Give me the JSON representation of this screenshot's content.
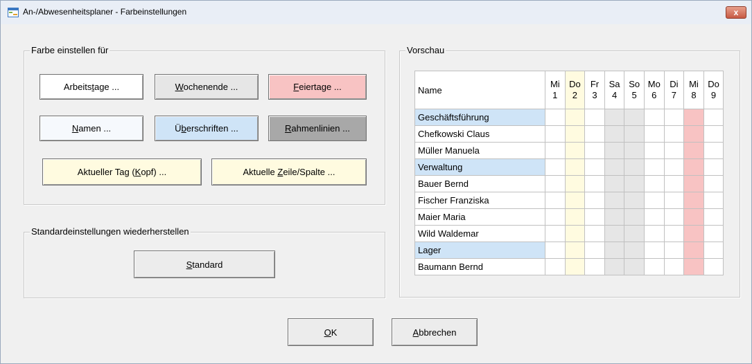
{
  "window": {
    "title": "An-/Abwesenheitsplaner - Farbeinstellungen",
    "close_label": "x"
  },
  "colors": {
    "titlebar": "#e9eef6",
    "dialog_bg": "#f0f0f0",
    "workdays_bg": "#ffffff",
    "weekend_bg": "#e6e6e6",
    "holidays_bg": "#f8c3c3",
    "names_bg": "#f6f9fd",
    "headings_bg": "#cfe4f7",
    "frame_lines_bg": "#a8a8a8",
    "today_bg": "#fffbe0"
  },
  "color_group": {
    "legend": "Farbe einstellen für",
    "buttons": {
      "workdays": {
        "pre": "Arbeits",
        "acc": "t",
        "post": "age ..."
      },
      "weekend": {
        "pre": "",
        "acc": "W",
        "post": "ochenende ..."
      },
      "holidays": {
        "pre": "",
        "acc": "F",
        "post": "eiertage ..."
      },
      "names": {
        "pre": "",
        "acc": "N",
        "post": "amen ..."
      },
      "headings": {
        "pre": "Ü",
        "acc": "b",
        "post": "erschriften ..."
      },
      "frame_lines": {
        "pre": "",
        "acc": "R",
        "post": "ahmenlinien ..."
      },
      "today_head": {
        "pre": "Aktueller Tag (",
        "acc": "K",
        "post": "opf) ..."
      },
      "current_row": {
        "pre": "Aktuelle ",
        "acc": "Z",
        "post": "eile/Spalte ..."
      }
    }
  },
  "defaults_group": {
    "legend": "Standardeinstellungen wiederherstellen",
    "button": {
      "pre": "",
      "acc": "S",
      "post": "tandard"
    }
  },
  "preview": {
    "legend": "Vorschau",
    "name_header": "Name",
    "days": [
      {
        "dow": "Mi",
        "num": "1",
        "type": "work"
      },
      {
        "dow": "Do",
        "num": "2",
        "type": "today"
      },
      {
        "dow": "Fr",
        "num": "3",
        "type": "work"
      },
      {
        "dow": "Sa",
        "num": "4",
        "type": "weekend"
      },
      {
        "dow": "So",
        "num": "5",
        "type": "weekend"
      },
      {
        "dow": "Mo",
        "num": "6",
        "type": "work"
      },
      {
        "dow": "Di",
        "num": "7",
        "type": "work"
      },
      {
        "dow": "Mi",
        "num": "8",
        "type": "holiday"
      },
      {
        "dow": "Do",
        "num": "9",
        "type": "work"
      }
    ],
    "rows": [
      {
        "name": "Geschäftsführung",
        "kind": "group"
      },
      {
        "name": "Chefkowski Claus",
        "kind": "person"
      },
      {
        "name": "Müller Manuela",
        "kind": "person"
      },
      {
        "name": "Verwaltung",
        "kind": "group"
      },
      {
        "name": "Bauer Bernd",
        "kind": "person"
      },
      {
        "name": "Fischer Franziska",
        "kind": "person"
      },
      {
        "name": "Maier Maria",
        "kind": "person"
      },
      {
        "name": "Wild Waldemar",
        "kind": "person"
      },
      {
        "name": "Lager",
        "kind": "group"
      },
      {
        "name": "Baumann Bernd",
        "kind": "person"
      }
    ]
  },
  "footer": {
    "ok": {
      "pre": "",
      "acc": "O",
      "post": "K"
    },
    "cancel": {
      "pre": "",
      "acc": "A",
      "post": "bbrechen"
    }
  }
}
